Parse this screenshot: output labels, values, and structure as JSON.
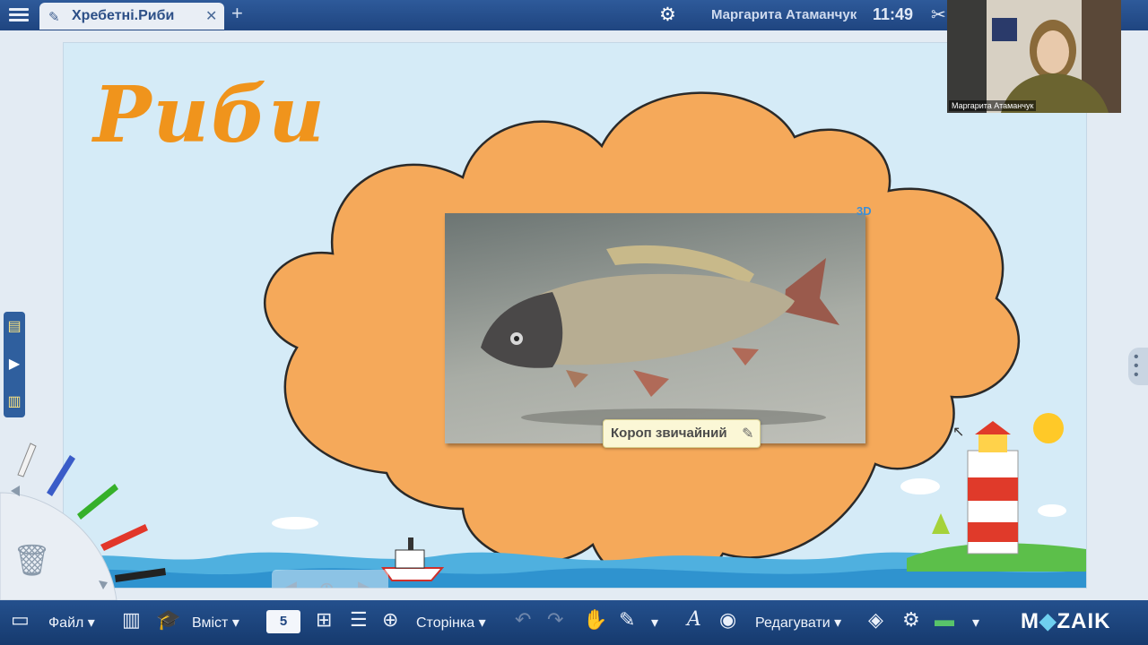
{
  "header": {
    "tab_title": "Хребетні.Риби",
    "tab_close": "✕",
    "new_tab": "+",
    "user_name": "Маргарита Атаманчук",
    "time": "11:49"
  },
  "slide": {
    "heading": "Риби",
    "badge": "3D",
    "image_caption": "Короп звичайний"
  },
  "video": {
    "participant_name": "Маргарита Атаманчук"
  },
  "toolbar": {
    "file_label": "Файл",
    "content_label": "Вміст",
    "page_number": "5",
    "page_label": "Сторінка",
    "edit_label": "Редагувати",
    "logo_left": "M",
    "logo_accent": "◆",
    "logo_right": "ZAIK"
  },
  "colors": {
    "heading": "#f0941c",
    "cloud": "#f5a95a",
    "toolbar": "#1f4580"
  },
  "icons": [
    "menu-icon",
    "pen-icon",
    "close-icon",
    "plus-icon",
    "gear-icon",
    "tools-icon",
    "arrow-left-icon",
    "add-page-icon",
    "arrow-right-icon",
    "pencil-icon",
    "trash-icon",
    "undo-icon",
    "redo-icon",
    "hand-icon",
    "eraser-icon",
    "text-icon",
    "record-icon",
    "check-icon",
    "mozaik-logo"
  ]
}
